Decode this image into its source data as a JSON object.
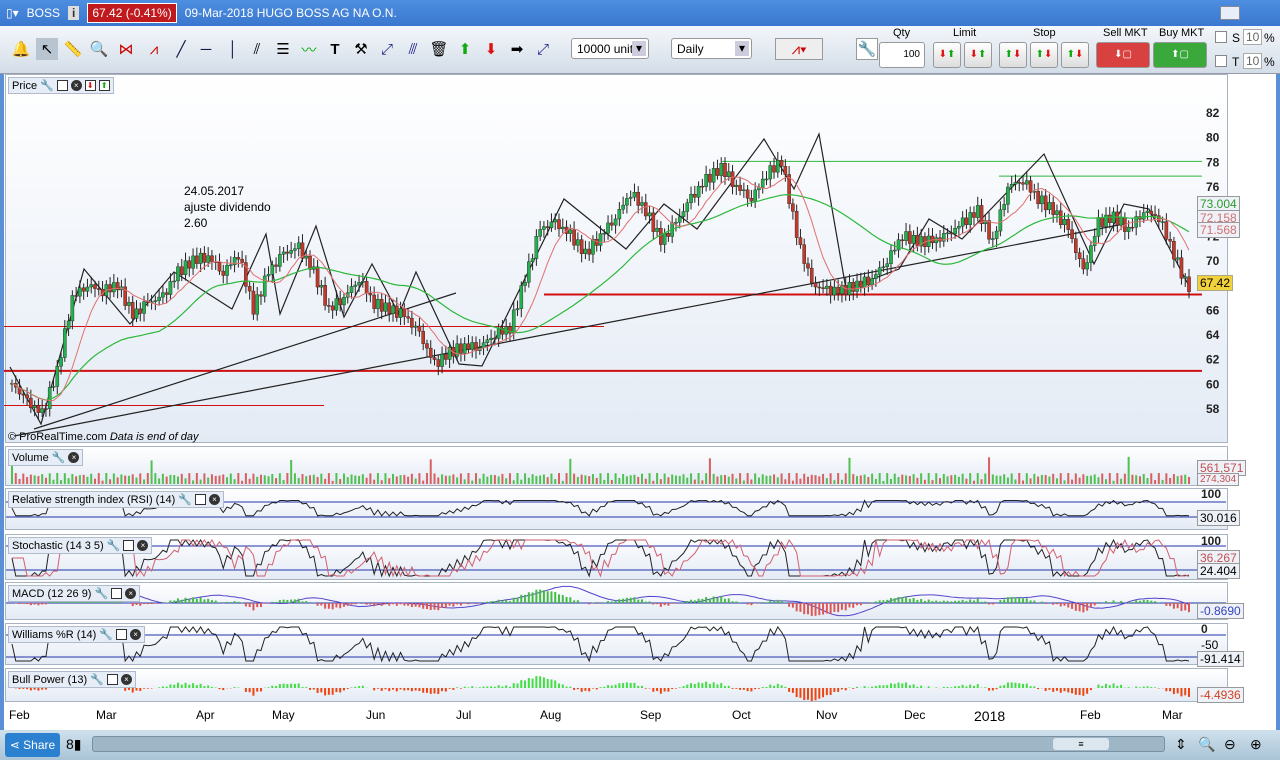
{
  "title": {
    "symbol": "BOSS",
    "price": "67.42 (-0.41%)",
    "date_name": "09-Mar-2018 HUGO BOSS AG NA O.N."
  },
  "toolbar": {
    "units": "10000 units",
    "period": "Daily",
    "qty_label": "Qty",
    "qty": "100",
    "limit_label": "Limit",
    "stop_label": "Stop",
    "sell_label": "Sell MKT",
    "buy_label": "Buy MKT",
    "s_label": "S",
    "t_label": "T",
    "s_pct": "10",
    "t_pct": "10",
    "pct": "%"
  },
  "panes": {
    "price": "Price",
    "volume": "Volume",
    "rsi": "Relative strength index (RSI) (14)",
    "stoch": "Stochastic (14 3 5)",
    "macd": "MACD (12 26 9)",
    "williams": "Williams %R (14)",
    "bull": "Bull Power (13)"
  },
  "annotation": {
    "line1": "24.05.2017",
    "line2": "ajuste dividendo",
    "line3": "2.60"
  },
  "watermark": "© ProRealTime.com",
  "eod": "Data is end of day",
  "values": {
    "last": "67.42",
    "ma1": "73.004",
    "ma2": "72.158",
    "ma3": "71.568",
    "vol1": "561,571",
    "vol2": "274,304",
    "rsi": "30.016",
    "stoch1": "36.267",
    "stoch2": "24.404",
    "macd": "-0.8690",
    "will": "-91.414",
    "bull": "-4.4936",
    "rsi100": "100",
    "stoch100": "100",
    "will0": "0",
    "will50": "-50"
  },
  "share": "Share",
  "colors": {
    "up": "#22b14c",
    "down": "#c0392b",
    "hline": "#d01010",
    "ma_green": "#2db83d",
    "ma_red": "#e07070"
  },
  "chart_data": {
    "type": "candlestick",
    "title": "HUGO BOSS AG NA O.N. Daily",
    "x_ticks": [
      "Feb",
      "Mar",
      "Apr",
      "May",
      "Jun",
      "Jul",
      "Aug",
      "Sep",
      "Oct",
      "Nov",
      "Dec",
      "2018",
      "Feb",
      "Mar"
    ],
    "y_ticks": [
      58,
      60,
      62,
      64,
      66,
      68,
      70,
      72,
      74,
      76,
      78,
      80,
      82
    ],
    "ylim": [
      55.5,
      83
    ],
    "closes": [
      60,
      58.5,
      57.5,
      61,
      67,
      68,
      67.5,
      68,
      65.5,
      66.5,
      67,
      69,
      70,
      70.3,
      69,
      70.5,
      66,
      69,
      70.5,
      71,
      69,
      66,
      67,
      68.5,
      66.5,
      66,
      65.5,
      64,
      61.5,
      62.5,
      63,
      63,
      64,
      64.5,
      68.5,
      72.5,
      73,
      72,
      70.5,
      72,
      73.5,
      75.5,
      74,
      71.5,
      73,
      75,
      76.5,
      77.5,
      76,
      75,
      77,
      78,
      72,
      68,
      67.5,
      67.5,
      68,
      68.5,
      70,
      72,
      71.5,
      71.5,
      72,
      73,
      74,
      71.5,
      76,
      76.5,
      75,
      74,
      72.5,
      69,
      73,
      73.5,
      72.5,
      74,
      73.5,
      70.5,
      67.42
    ],
    "horizontal_lines": [
      67.2,
      61,
      64.6,
      58.2,
      78,
      76.8
    ]
  }
}
